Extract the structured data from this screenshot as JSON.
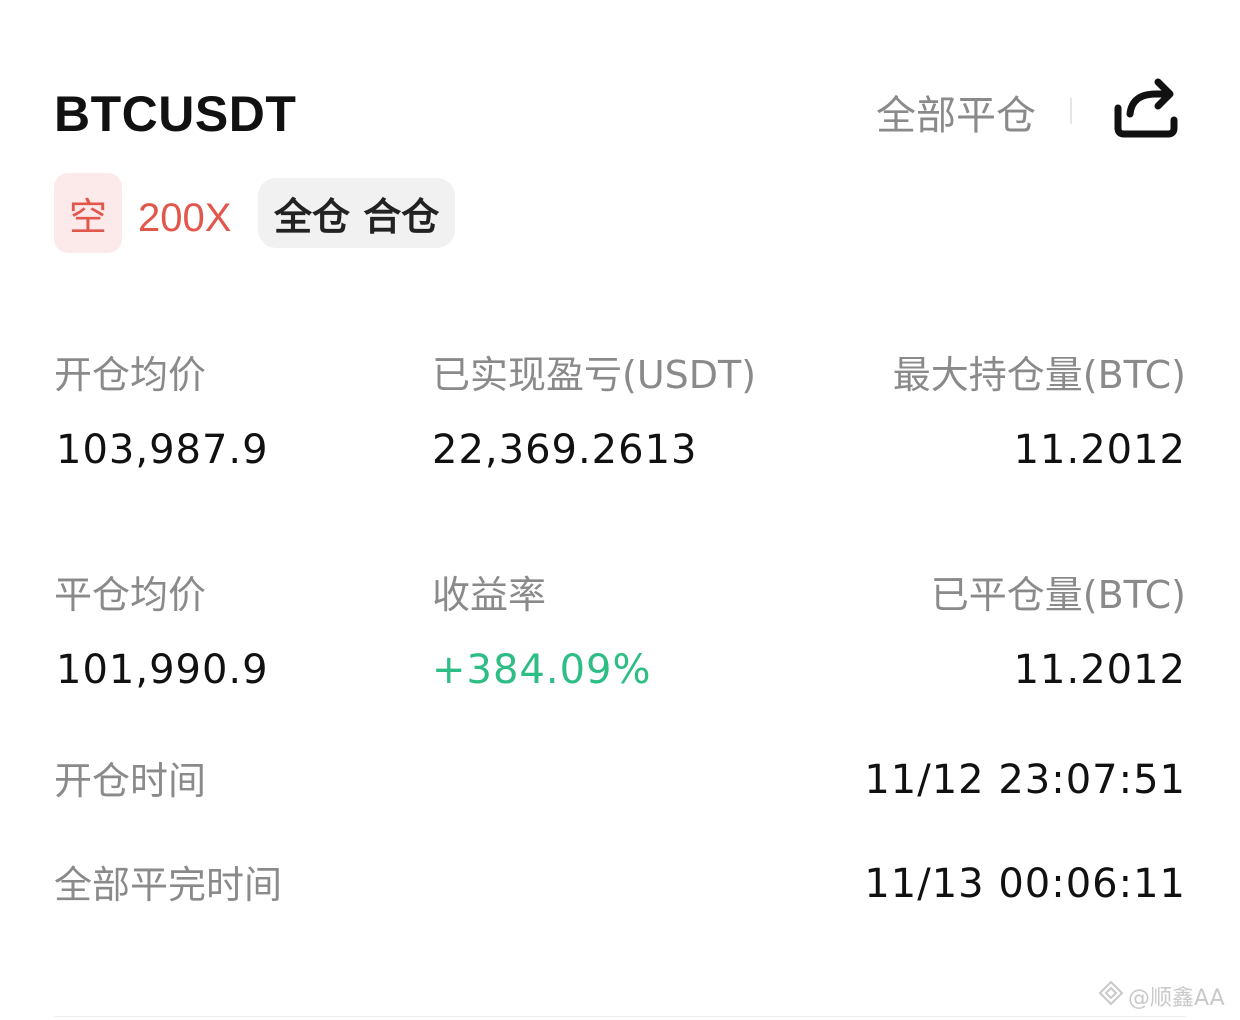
{
  "header": {
    "symbol": "BTCUSDT",
    "close_all_label": "全部平仓"
  },
  "tags": {
    "direction": "空",
    "leverage": "200X",
    "margin_mode": "全仓 合仓"
  },
  "fields": {
    "avg_open_price": {
      "label": "开仓均价",
      "value": "103,987.9"
    },
    "realized_pnl": {
      "label": "已实现盈亏(USDT)",
      "value": "22,369.2613"
    },
    "max_position": {
      "label": "最大持仓量(BTC)",
      "value": "11.2012"
    },
    "avg_close_price": {
      "label": "平仓均价",
      "value": "101,990.9"
    },
    "roi": {
      "label": "收益率",
      "value": "+384.09%"
    },
    "closed_amount": {
      "label": "已平仓量(BTC)",
      "value": "11.2012"
    },
    "open_time": {
      "label": "开仓时间",
      "value": "11/12 23:07:51"
    },
    "full_close_time": {
      "label": "全部平完时间",
      "value": "11/13 00:06:11"
    }
  },
  "watermark": {
    "text": "@顺鑫AA",
    "icon": "brand-logo-icon"
  },
  "colors": {
    "short_red": "#e2574c",
    "short_bg": "#fce9e9",
    "profit_green": "#2ebd85",
    "label_gray": "#8a8a8a"
  },
  "icons": {
    "share": "share-icon"
  }
}
